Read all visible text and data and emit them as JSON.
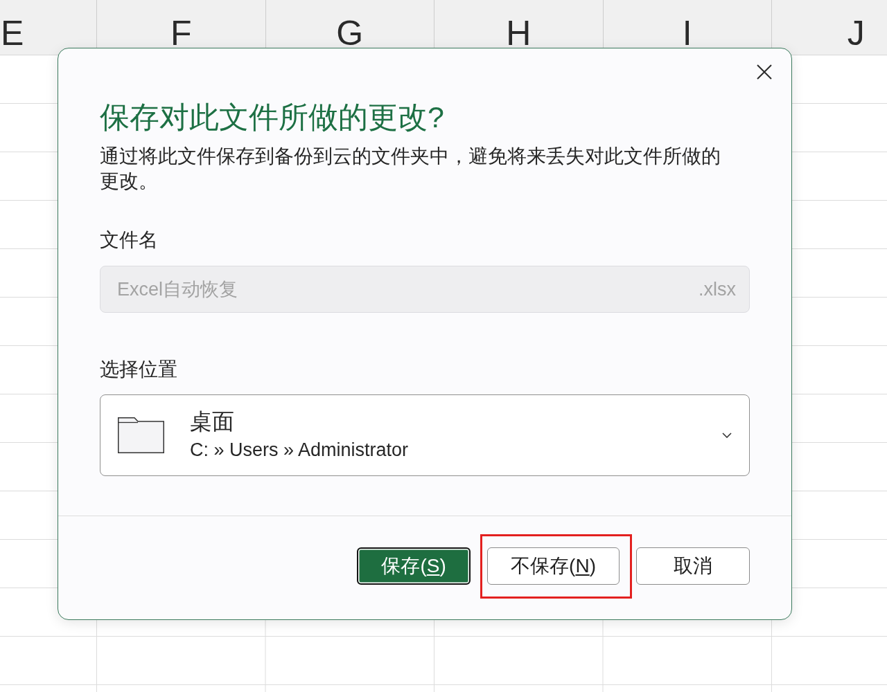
{
  "sheet": {
    "column_headers": [
      "E",
      "F",
      "G",
      "H",
      "I",
      "J"
    ]
  },
  "dialog": {
    "title": "保存对此文件所做的更改?",
    "description": "通过将此文件保存到备份到云的文件夹中，避免将来丢失对此文件所做的更改。",
    "filename": {
      "label": "文件名",
      "placeholder": "Excel自动恢复",
      "extension": ".xlsx"
    },
    "location": {
      "label": "选择位置",
      "name": "桌面",
      "path": "C: » Users » Administrator"
    },
    "buttons": [
      {
        "kind": "primary",
        "label_start": "保存(",
        "access_key": "S",
        "label_end": ")",
        "focused": true,
        "highlighted": false
      },
      {
        "kind": "secondary",
        "label_start": "不保存(",
        "access_key": "N",
        "label_end": ")",
        "focused": false,
        "highlighted": true
      },
      {
        "kind": "secondary",
        "label_start": "取消",
        "focused": false,
        "highlighted": false
      }
    ]
  }
}
